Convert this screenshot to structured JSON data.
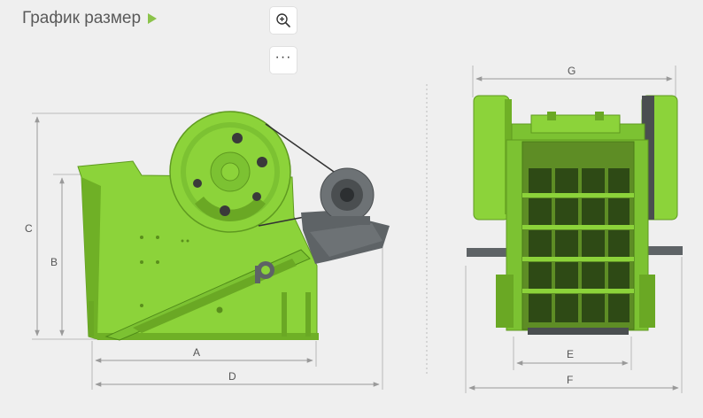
{
  "header": {
    "title": "График размер"
  },
  "toolbar": {
    "zoom_icon": "zoom-in-icon",
    "more_label": "···"
  },
  "dimensions": {
    "A": "A",
    "B": "B",
    "C": "C",
    "D": "D",
    "E": "E",
    "F": "F",
    "G": "G"
  },
  "colors": {
    "machine_green": "#8cd33a",
    "dark_gray": "#5e6366",
    "accent": "#8bc34a"
  }
}
